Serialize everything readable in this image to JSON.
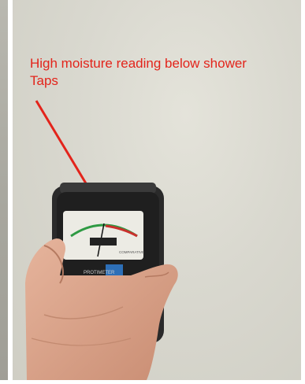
{
  "annotation": {
    "line1": "High moisture reading below shower",
    "line2": "Taps",
    "color": "#e3241b"
  },
  "device": {
    "brand_text": "PROTIMETER",
    "scale_text": "COMPARATIVE"
  }
}
